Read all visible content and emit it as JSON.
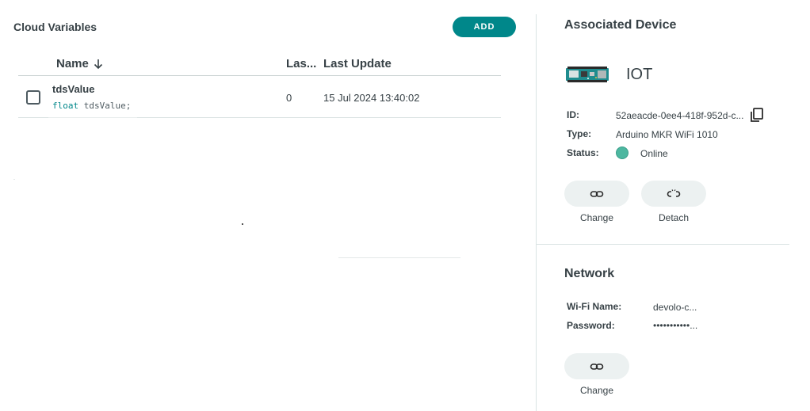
{
  "cloud_variables": {
    "title": "Cloud Variables",
    "add_label": "ADD",
    "columns": {
      "name": "Name",
      "last_value": "Las...",
      "last_update": "Last Update"
    },
    "rows": [
      {
        "name": "tdsValue",
        "type_keyword": "float",
        "declaration_rest": " tdsValue;",
        "last_value": "0",
        "last_update": "15 Jul 2024 13:40:02"
      }
    ]
  },
  "associated_device": {
    "title": "Associated Device",
    "device_name": "IOT",
    "id_label": "ID:",
    "id_value": "52aeacde-0ee4-418f-952d-c...",
    "type_label": "Type:",
    "type_value": "Arduino MKR WiFi 1010",
    "status_label": "Status:",
    "status_value": "Online",
    "change_label": "Change",
    "detach_label": "Detach",
    "status_color": "#4db7a0"
  },
  "network": {
    "title": "Network",
    "wifi_label": "Wi-Fi Name:",
    "wifi_value": "devolo-c...",
    "password_label": "Password:",
    "password_value": "•••••••••••...",
    "change_label": "Change"
  },
  "colors": {
    "accent": "#00878a",
    "text": "#374146",
    "pill_bg": "#ecf1f1"
  }
}
